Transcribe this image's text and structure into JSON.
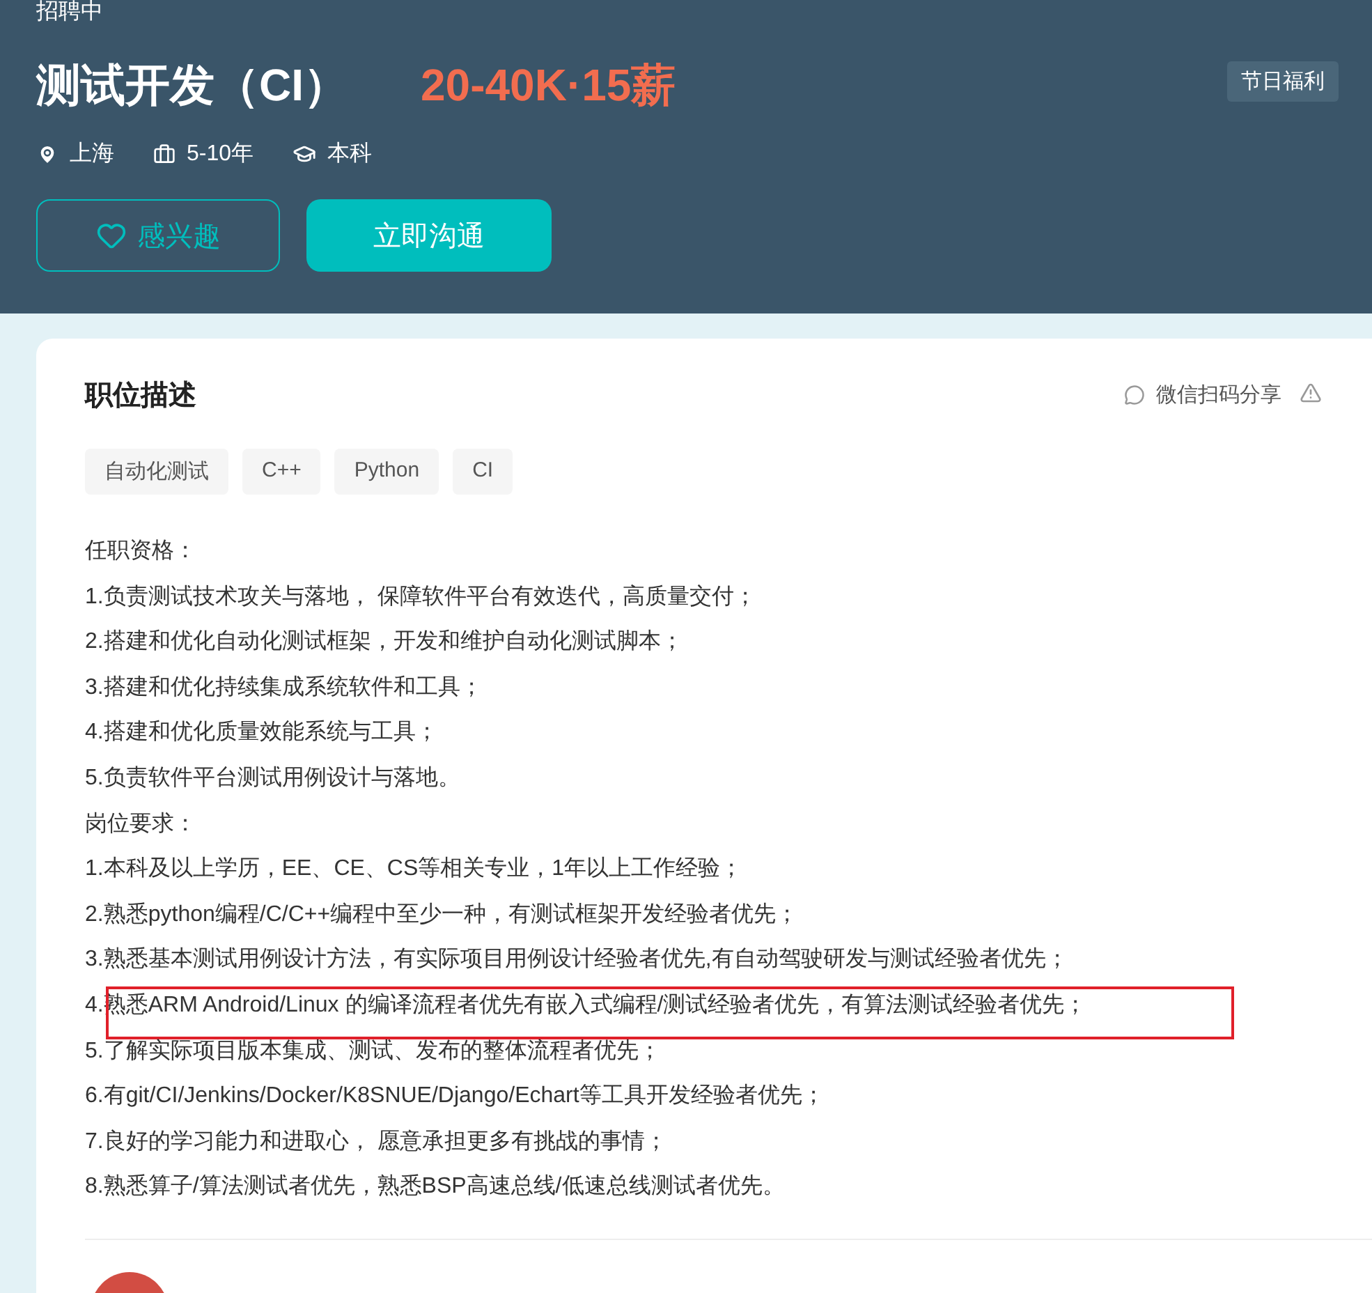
{
  "header": {
    "status": "招聘中",
    "title": "测试开发（CI）",
    "salary": "20-40K·15薪",
    "benefits": [
      "节日福利"
    ],
    "meta": [
      {
        "kind": "location",
        "text": "上海"
      },
      {
        "kind": "experience",
        "text": "5-10年"
      },
      {
        "kind": "degree",
        "text": "本科"
      }
    ],
    "buttons": [
      {
        "kind": "interest",
        "label": "感兴趣"
      },
      {
        "kind": "chat",
        "label": "立即沟通"
      }
    ]
  },
  "card": {
    "title": "职位描述",
    "share": "微信扫码分享",
    "tags": [
      "自动化测试",
      "C++",
      "Python",
      "CI"
    ],
    "lines": [
      {
        "text": "任职资格：",
        "highlighted": false
      },
      {
        "text": "1.负责测试技术攻关与落地， 保障软件平台有效迭代，高质量交付；",
        "highlighted": false
      },
      {
        "text": "2.搭建和优化自动化测试框架，开发和维护自动化测试脚本；",
        "highlighted": false
      },
      {
        "text": "3.搭建和优化持续集成系统软件和工具；",
        "highlighted": false
      },
      {
        "text": "4.搭建和优化质量效能系统与工具；",
        "highlighted": false
      },
      {
        "text": "5.负责软件平台测试用例设计与落地。",
        "highlighted": false
      },
      {
        "text": "岗位要求：",
        "highlighted": false
      },
      {
        "text": "1.本科及以上学历，EE、CE、CS等相关专业，1年以上工作经验；",
        "highlighted": false
      },
      {
        "text": "2.熟悉python编程/C/C++编程中至少一种，有测试框架开发经验者优先；",
        "highlighted": false
      },
      {
        "text": "3.熟悉基本测试用例设计方法，有实际项目用例设计经验者优先,有自动驾驶研发与测试经验者优先；",
        "highlighted": false
      },
      {
        "text": "4.熟悉ARM Android/Linux 的编译流程者优先有嵌入式编程/测试经验者优先，有算法测试经验者优先；",
        "highlighted": true
      },
      {
        "text": "5.了解实际项目版本集成、测试、发布的整体流程者优先；",
        "highlighted": false
      },
      {
        "text": "6.有git/CI/Jenkins/Docker/K8SNUE/Django/Echart等工具开发经验者优先；",
        "highlighted": false
      },
      {
        "text": "7.良好的学习能力和进取心， 愿意承担更多有挑战的事情；",
        "highlighted": false
      },
      {
        "text": "8.熟悉算子/算法测试者优先，熟悉BSP高速总线/低速总线测试者优先。",
        "highlighted": false
      }
    ]
  }
}
